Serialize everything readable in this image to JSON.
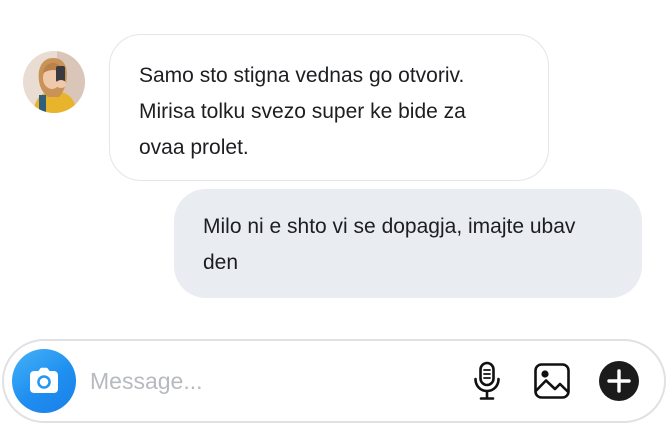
{
  "messages": [
    {
      "direction": "incoming",
      "lines": [
        "Samo sto stigna vednas go otvoriv.",
        "Mirisa tolku svezo super ke bide za",
        "ovaa prolet."
      ]
    },
    {
      "direction": "outgoing",
      "lines": [
        "Milo ni e shto vi se dopagja, imajte ubav",
        "den"
      ]
    }
  ],
  "composer": {
    "placeholder": "Message...",
    "value": "",
    "icons": {
      "camera": "camera-icon",
      "microphone": "microphone-icon",
      "gallery": "image-icon",
      "add": "plus-circle-icon"
    }
  },
  "colors": {
    "incoming_bubble_bg": "#ffffff",
    "incoming_bubble_border": "#e3e5e8",
    "outgoing_bubble_bg": "#e9ecf1",
    "camera_button": "#1f8ff0",
    "text": "#1c1e21",
    "placeholder": "#b7babe"
  }
}
